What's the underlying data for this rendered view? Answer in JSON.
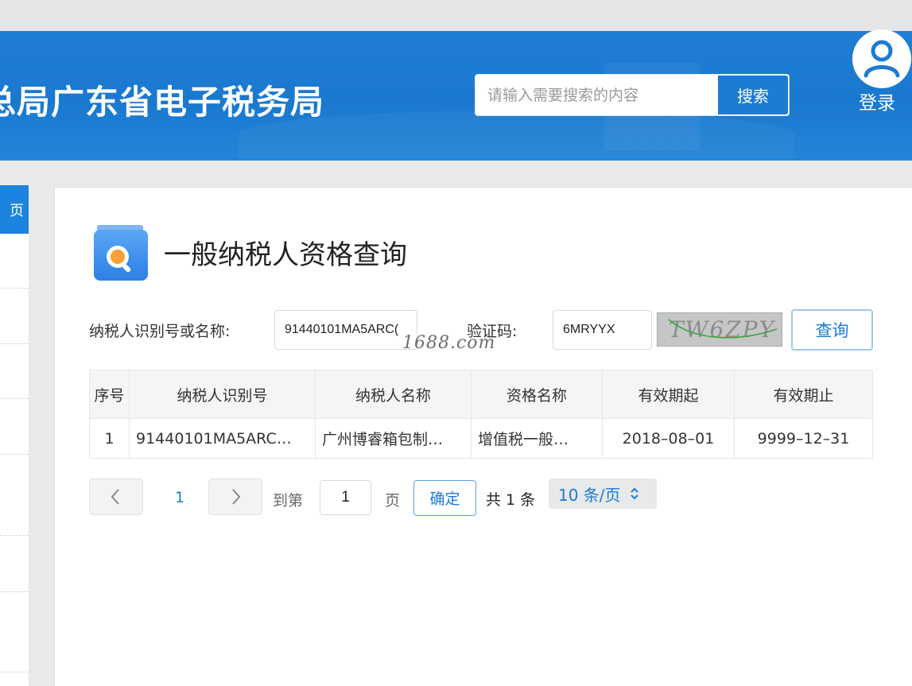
{
  "header": {
    "site_title": "总局广东省电子税务局",
    "search_placeholder": "请输入需要搜索的内容",
    "search_button": "搜索",
    "login_label": "登录"
  },
  "sidebar": {
    "active_item_label": "页"
  },
  "main": {
    "page_title": "一般纳税人资格查询",
    "form": {
      "taxpayer_label": "纳税人识别号或名称:",
      "taxpayer_value": "91440101MA5ARC(",
      "captcha_label": "验证码:",
      "captcha_value": "6MRYYX",
      "captcha_image_text": "TW6ZPY",
      "query_button": "查询"
    },
    "watermark": "1688.com",
    "table": {
      "headers": [
        "序号",
        "纳税人识别号",
        "纳税人名称",
        "资格名称",
        "有效期起",
        "有效期止"
      ],
      "rows": [
        [
          "1",
          "91440101MA5ARC…",
          "广州博睿箱包制…",
          "增值税一般…",
          "2018–08–01",
          "9999–12–31"
        ]
      ]
    },
    "pagination": {
      "prev_icon": "chevron-left-icon",
      "current_page": "1",
      "next_icon": "chevron-right-icon",
      "goto_label": "到第",
      "goto_value": "1",
      "page_unit": "页",
      "confirm_button": "确定",
      "total_text": "共 1 条",
      "page_size": "10 条/页"
    }
  },
  "colors": {
    "header_blue": "#1f7ed4",
    "accent_blue": "#1a7bd4",
    "sidebar_active": "#1c83de"
  }
}
